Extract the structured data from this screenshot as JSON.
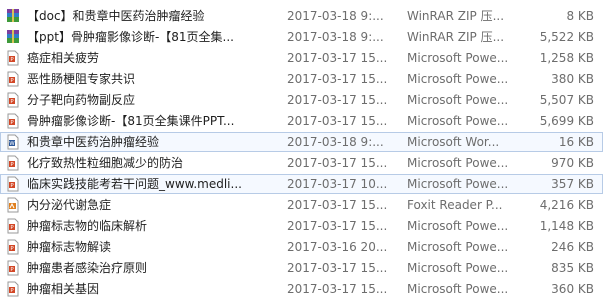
{
  "rows": [
    {
      "name": "【doc】和贵章中医药治肿瘤经验",
      "date": "2017-03-18 9:...",
      "type": "WinRAR ZIP 压...",
      "size": "8 KB",
      "icon": "winrar-icon"
    },
    {
      "name": "【ppt】骨肿瘤影像诊断-【81页全集...",
      "date": "2017-03-18 9:...",
      "type": "WinRAR ZIP 压...",
      "size": "5,522 KB",
      "icon": "winrar-icon"
    },
    {
      "name": "癌症相关疲劳",
      "date": "2017-03-17 15...",
      "type": "Microsoft Powe...",
      "size": "1,258 KB",
      "icon": "powerpoint-icon"
    },
    {
      "name": "恶性肠梗阻专家共识",
      "date": "2017-03-17 15...",
      "type": "Microsoft Powe...",
      "size": "380 KB",
      "icon": "powerpoint-icon"
    },
    {
      "name": "分子靶向药物副反应",
      "date": "2017-03-17 15...",
      "type": "Microsoft Powe...",
      "size": "5,507 KB",
      "icon": "powerpoint-icon"
    },
    {
      "name": "骨肿瘤影像诊断-【81页全集课件PPT...",
      "date": "2017-03-17 15...",
      "type": "Microsoft Powe...",
      "size": "5,699 KB",
      "icon": "powerpoint-icon"
    },
    {
      "name": "和贵章中医药治肿瘤经验",
      "date": "2017-03-18 9:...",
      "type": "Microsoft Wor...",
      "size": "16 KB",
      "icon": "word-icon"
    },
    {
      "name": "化疗致热性粒细胞减少的防治",
      "date": "2017-03-17 15...",
      "type": "Microsoft Powe...",
      "size": "970 KB",
      "icon": "powerpoint-icon"
    },
    {
      "name": "临床实践技能考若干问题_www.medli...",
      "date": "2017-03-17 10...",
      "type": "Microsoft Powe...",
      "size": "357 KB",
      "icon": "powerpoint-icon"
    },
    {
      "name": "内分泌代谢急症",
      "date": "2017-03-17 15...",
      "type": "Foxit Reader P...",
      "size": "4,216 KB",
      "icon": "pdf-icon"
    },
    {
      "name": "肿瘤标志物的临床解析",
      "date": "2017-03-17 15...",
      "type": "Microsoft Powe...",
      "size": "1,148 KB",
      "icon": "powerpoint-icon"
    },
    {
      "name": "肿瘤标志物解读",
      "date": "2017-03-16 20...",
      "type": "Microsoft Powe...",
      "size": "246 KB",
      "icon": "powerpoint-icon"
    },
    {
      "name": "肿瘤患者感染治疗原则",
      "date": "2017-03-17 15...",
      "type": "Microsoft Powe...",
      "size": "835 KB",
      "icon": "powerpoint-icon"
    },
    {
      "name": "肿瘤相关基因",
      "date": "2017-03-17 15...",
      "type": "Microsoft Powe...",
      "size": "360 KB",
      "icon": "powerpoint-icon"
    }
  ],
  "selected_rows": [
    6,
    8
  ],
  "colors": {
    "selection_border": "#b7cbe6",
    "selection_bg": "#f5f9ff",
    "ppt": "#d24726",
    "word": "#2b579a",
    "pdf": "#e0801f"
  }
}
